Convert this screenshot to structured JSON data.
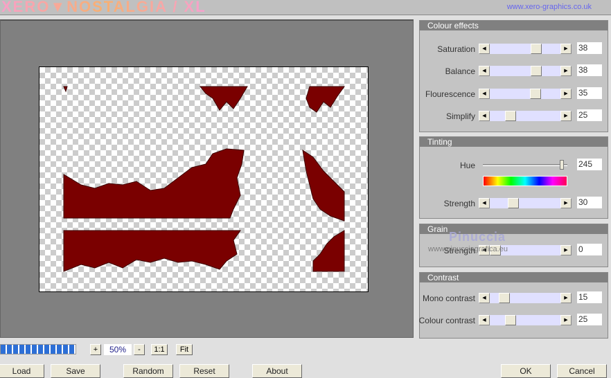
{
  "header": {
    "logo": "XERO▼NOSTALGIA / XL",
    "link": "www.xero-graphics.co.uk"
  },
  "colours": {
    "accent": "#808080",
    "track": "#e0e0ff",
    "progress": "#2d6fd6",
    "shape": "#7a0000"
  },
  "panels": [
    {
      "title": "Colour effects",
      "sliders": [
        {
          "label": "Saturation",
          "value": 38,
          "min": -100,
          "max": 100
        },
        {
          "label": "Balance",
          "value": 38,
          "min": -100,
          "max": 100
        },
        {
          "label": "Flourescence",
          "value": 35,
          "min": -100,
          "max": 100
        },
        {
          "label": "Simplify",
          "value": 25,
          "min": 0,
          "max": 100
        }
      ]
    },
    {
      "title": "Tinting",
      "hue": {
        "label": "Hue",
        "value": 245,
        "min": 0,
        "max": 255
      },
      "sliders": [
        {
          "label": "Strength",
          "value": 30,
          "min": 0,
          "max": 100
        }
      ]
    },
    {
      "title": "Grain",
      "sliders": [
        {
          "label": "Strength",
          "value": 0,
          "min": 0,
          "max": 100
        }
      ]
    },
    {
      "title": "Contrast",
      "sliders": [
        {
          "label": "Mono contrast",
          "value": 15,
          "min": 0,
          "max": 100
        },
        {
          "label": "Colour contrast",
          "value": 25,
          "min": 0,
          "max": 100
        }
      ]
    }
  ],
  "watermark": {
    "name": "Pinuccia",
    "url": "www.pinucciagrafica.eu"
  },
  "zoom": {
    "plus": "+",
    "level": "50%",
    "minus": "-",
    "actual": "1:1",
    "fit": "Fit",
    "progress_percent": 100
  },
  "buttons": {
    "load": "Load",
    "save": "Save",
    "random": "Random",
    "reset": "Reset",
    "about": "About",
    "ok": "OK",
    "cancel": "Cancel"
  },
  "icons": {
    "left_arrow": "triangle-left-icon",
    "right_arrow": "triangle-right-icon"
  }
}
